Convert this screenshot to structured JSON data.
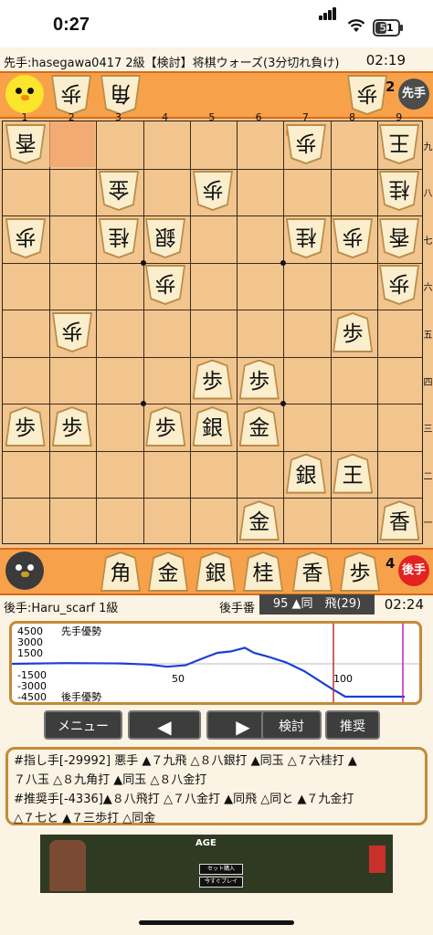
{
  "status": {
    "time": "0:27",
    "battery": "51"
  },
  "header": {
    "info": "先手:hasegawa0417 2級【検討】将棋ウォーズ(3分切れ負け)",
    "sente_clock": "02:19"
  },
  "sente_hand": {
    "pieces": [
      "歩",
      "角"
    ],
    "count_fu": "2",
    "badge": "先手"
  },
  "gote_hand": {
    "pieces": [
      "角",
      "金",
      "銀",
      "桂",
      "香",
      "歩"
    ],
    "count_fu": "4",
    "badge": "後手"
  },
  "board": {
    "files": [
      "1",
      "2",
      "3",
      "4",
      "5",
      "6",
      "7",
      "8",
      "9"
    ],
    "ranks": [
      "九",
      "八",
      "七",
      "六",
      "五",
      "四",
      "三",
      "二",
      "一"
    ],
    "gote_pieces": [
      {
        "label": "香",
        "col": 0,
        "row": 0
      },
      {
        "label": "歩",
        "col": 6,
        "row": 0
      },
      {
        "label": "王",
        "col": 8,
        "row": 0
      },
      {
        "label": "金",
        "col": 2,
        "row": 1
      },
      {
        "label": "歩",
        "col": 4,
        "row": 1
      },
      {
        "label": "桂",
        "col": 8,
        "row": 1
      },
      {
        "label": "歩",
        "col": 0,
        "row": 2
      },
      {
        "label": "桂",
        "col": 2,
        "row": 2
      },
      {
        "label": "銀",
        "col": 3,
        "row": 2
      },
      {
        "label": "桂",
        "col": 6,
        "row": 2
      },
      {
        "label": "歩",
        "col": 7,
        "row": 2
      },
      {
        "label": "香",
        "col": 8,
        "row": 2
      },
      {
        "label": "歩",
        "col": 3,
        "row": 3
      },
      {
        "label": "歩",
        "col": 8,
        "row": 3
      },
      {
        "label": "歩",
        "col": 1,
        "row": 4
      }
    ],
    "sente_pieces": [
      {
        "label": "歩",
        "col": 7,
        "row": 4
      },
      {
        "label": "歩",
        "col": 4,
        "row": 5
      },
      {
        "label": "歩",
        "col": 5,
        "row": 5
      },
      {
        "label": "歩",
        "col": 0,
        "row": 6
      },
      {
        "label": "歩",
        "col": 1,
        "row": 6
      },
      {
        "label": "歩",
        "col": 3,
        "row": 6
      },
      {
        "label": "銀",
        "col": 4,
        "row": 6
      },
      {
        "label": "金",
        "col": 5,
        "row": 6
      },
      {
        "label": "銀",
        "col": 6,
        "row": 7
      },
      {
        "label": "王",
        "col": 7,
        "row": 7
      },
      {
        "label": "金",
        "col": 5,
        "row": 8
      },
      {
        "label": "香",
        "col": 8,
        "row": 8
      }
    ]
  },
  "game_bar": {
    "gote_player": "後手:Haru_scarf 1級",
    "turn": "後手番",
    "move": "95 ▲同　飛(29)",
    "gote_clock": "02:24"
  },
  "graph": {
    "y_labels": [
      "4500",
      "3000",
      "1500",
      "-1500",
      "-3000",
      "-4500"
    ],
    "top_text": "先手優勢",
    "bottom_text": "後手優勢",
    "x_marks": [
      "50",
      "100"
    ],
    "colors": {
      "line": "#1a3fd6",
      "cursor": "#c03030",
      "end": "#c020c0"
    }
  },
  "buttons": {
    "menu": "メニュー",
    "prev": "◀",
    "next": "▶",
    "analyze": "検討",
    "recommend": "推奨"
  },
  "comment": {
    "line1": "#指し手[-29992] 悪手 ▲７九飛 △８八銀打 ▲同玉 △７六桂打 ▲",
    "line2": "７八玉 △８九角打 ▲同玉 △８八金打",
    "line3": "#推奨手[-4336]▲８八飛打 △７八金打 ▲同飛 △同と ▲７九金打",
    "line4": "△７七と ▲７三歩打 △同金"
  },
  "ad": {
    "logo": "AGE",
    "btn1": "セット購入",
    "btn2": "今すぐプレイ"
  }
}
